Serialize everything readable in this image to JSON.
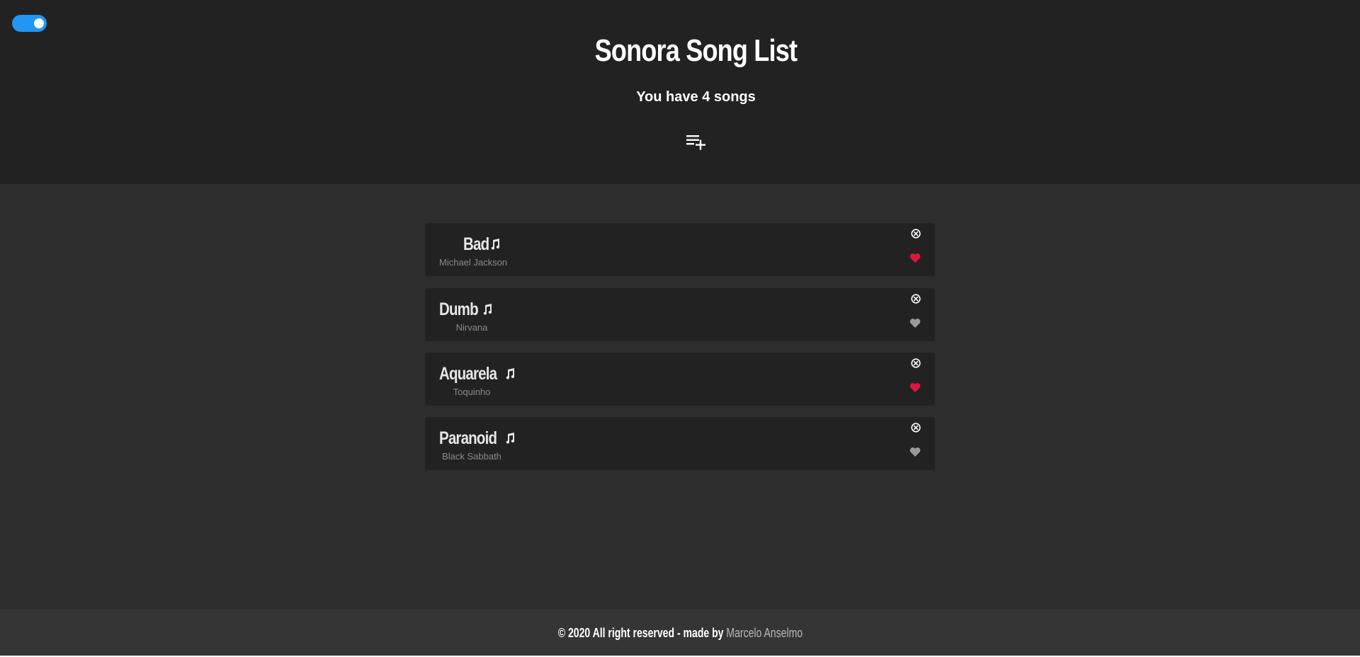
{
  "header": {
    "title": "Sonora Song List",
    "subtitle": "You have 4 songs",
    "theme_toggle_on": true,
    "add_icon": "playlist-add-icon"
  },
  "songs": [
    {
      "title": "Bad",
      "artist": "Michael Jackson",
      "favorite": true
    },
    {
      "title": "Dumb",
      "artist": "Nirvana",
      "favorite": false
    },
    {
      "title": "Aquarela",
      "artist": "Toquinho",
      "favorite": true
    },
    {
      "title": "Paranoid",
      "artist": "Black Sabbath",
      "favorite": false
    }
  ],
  "footer": {
    "text": "© 2020 All right reserved - made by ",
    "author": "Marcelo Anselmo"
  },
  "colors": {
    "header_bg": "#232223",
    "main_bg": "#2d2d2d",
    "card_bg": "#232223",
    "footer_bg": "#353535",
    "toggle": "#2196f3",
    "heart_active": "#e0143c",
    "heart_inactive": "#9a9a9a"
  }
}
